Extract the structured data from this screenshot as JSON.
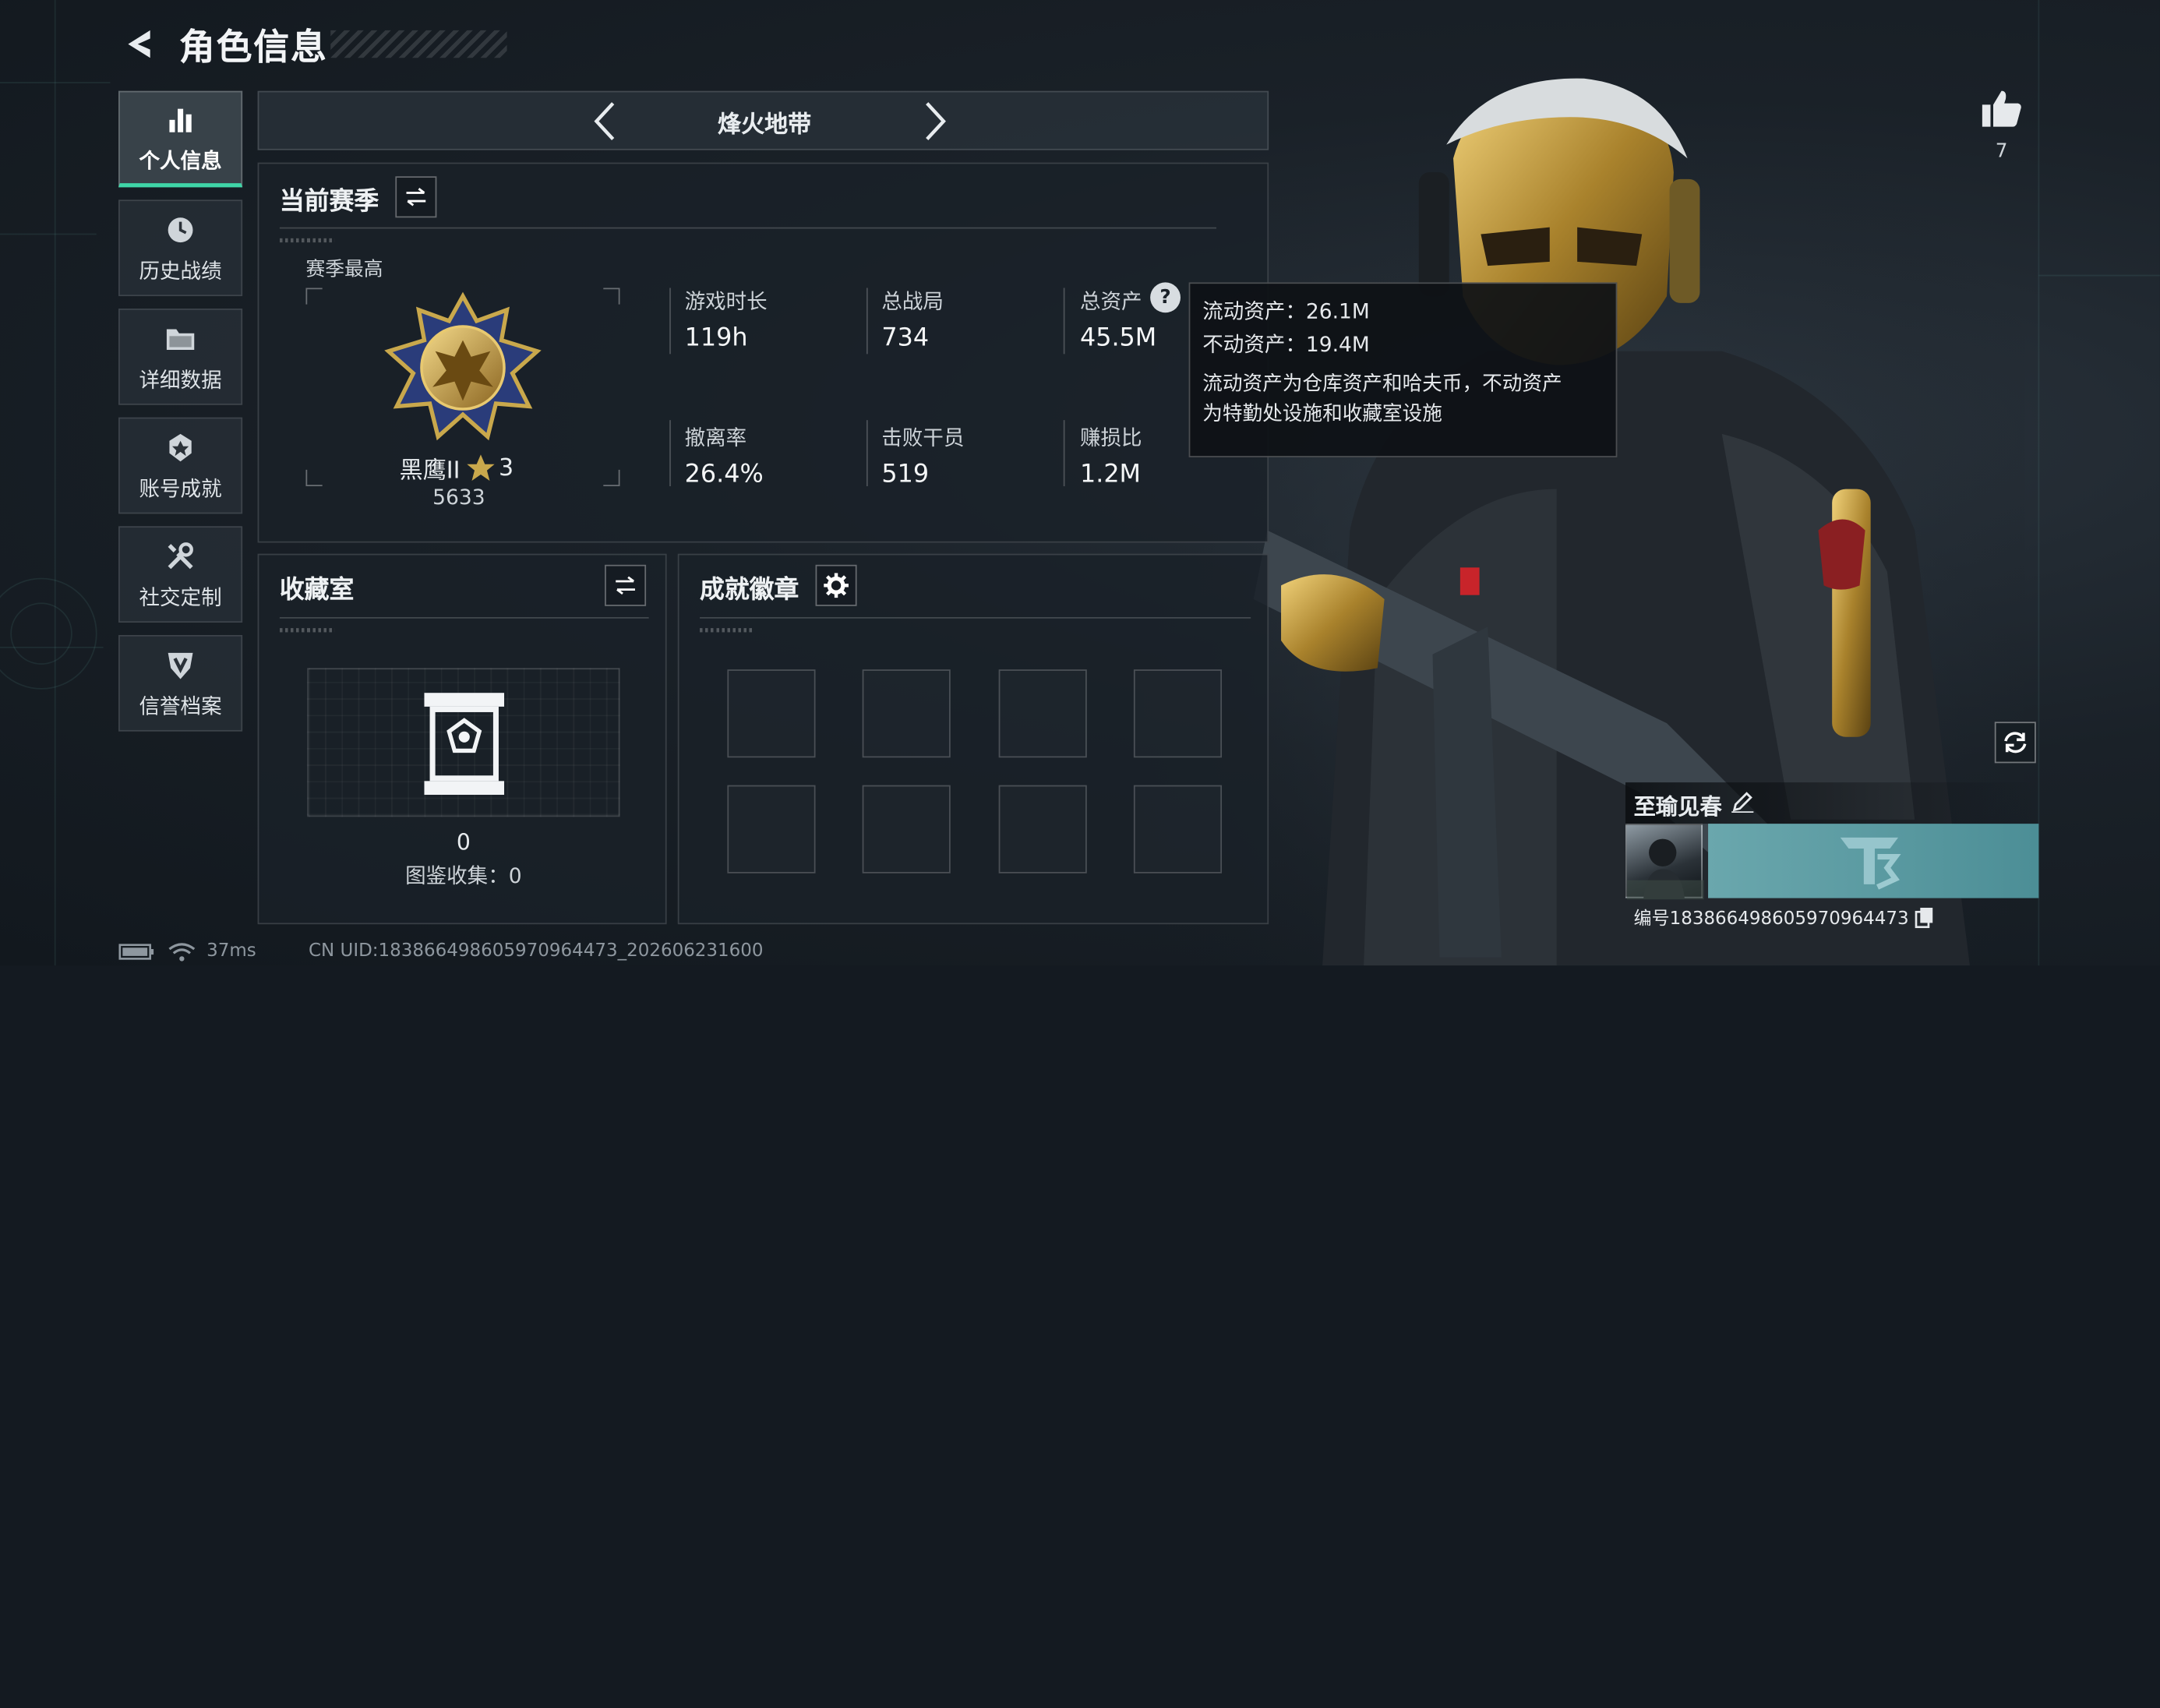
{
  "header": {
    "title": "角色信息"
  },
  "sidebar": {
    "items": [
      {
        "label": "个人信息",
        "icon": "bar-chart-icon",
        "active": true
      },
      {
        "label": "历史战绩",
        "icon": "history-icon",
        "active": false
      },
      {
        "label": "详细数据",
        "icon": "folder-icon",
        "active": false
      },
      {
        "label": "账号成就",
        "icon": "achievement-icon",
        "active": false
      },
      {
        "label": "社交定制",
        "icon": "tools-icon",
        "active": false
      },
      {
        "label": "信誉档案",
        "icon": "shield-icon",
        "active": false
      }
    ]
  },
  "mode_selector": {
    "label": "烽火地带"
  },
  "season": {
    "title": "当前赛季",
    "rank_caption": "赛季最高",
    "rank_name": "黑鹰II",
    "rank_stars": "3",
    "rank_points": "5633",
    "stats": [
      {
        "label": "游戏时长",
        "value": "119h"
      },
      {
        "label": "总战局",
        "value": "734"
      },
      {
        "label": "总资产",
        "value": "45.5M"
      },
      {
        "label": "撤离率",
        "value": "26.4%"
      },
      {
        "label": "击败干员",
        "value": "519"
      },
      {
        "label": "赚损比",
        "value": "1.2M"
      }
    ]
  },
  "tooltip": {
    "liquid": "流动资产：26.1M",
    "fixed": "不动资产：19.4M",
    "desc_line1": "流动资产为仓库资产和哈夫币，不动资产",
    "desc_line2": "为特勤处设施和收藏室设施"
  },
  "collection": {
    "title": "收藏室",
    "count": "0",
    "catalog": "图鉴收集：0"
  },
  "badges": {
    "title": "成就徽章"
  },
  "likes": {
    "count": "7"
  },
  "profile": {
    "name": "至瑜见春",
    "id_text": "编号183866498605970964473"
  },
  "status_bar": {
    "ping": "37ms",
    "uid": "CN UID:183866498605970964473_202606231600"
  },
  "colors": {
    "accent": "#3fd6a8",
    "gold": "#c9a84c",
    "panel": "#1a2128"
  }
}
